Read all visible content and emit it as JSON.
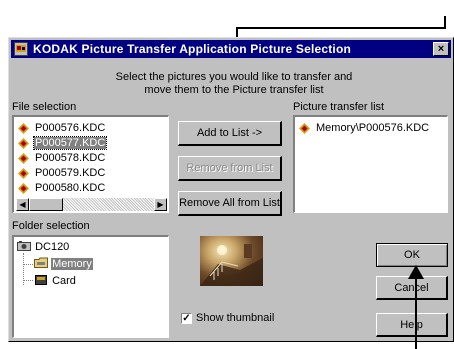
{
  "window": {
    "title": "KODAK Picture Transfer Application Picture Selection",
    "close_label": "×"
  },
  "instructions": {
    "line1": "Select the pictures you would like to transfer and",
    "line2": "move them to the Picture transfer list"
  },
  "file_selection": {
    "label": "File selection",
    "items": [
      {
        "name": "P000576.KDC"
      },
      {
        "name": "P000577.KDC",
        "selected": true
      },
      {
        "name": "P000578.KDC"
      },
      {
        "name": "P000579.KDC"
      },
      {
        "name": "P000580.KDC"
      }
    ]
  },
  "transfer_list": {
    "label": "Picture transfer list",
    "items": [
      {
        "name": "Memory\\P000576.KDC"
      }
    ]
  },
  "buttons": {
    "add": "Add to List ->",
    "remove": "Remove from List",
    "remove_all": "Remove All from List",
    "ok": "OK",
    "cancel": "Cancel",
    "help": "Help"
  },
  "folder_selection": {
    "label": "Folder selection",
    "root": "DC120",
    "children": [
      {
        "name": "Memory",
        "selected": true
      },
      {
        "name": "Card"
      }
    ]
  },
  "thumbnail": {
    "checkbox_label": "Show thumbnail",
    "checked": true
  },
  "colors": {
    "titlebar": "#000080",
    "face": "#c0c0c0",
    "kodak_icon": "#d4a017"
  },
  "icons": [
    "kodak-kdc-file-icon",
    "camera-icon",
    "folder-icon",
    "card-icon",
    "scroll-left-icon",
    "scroll-right-icon"
  ]
}
